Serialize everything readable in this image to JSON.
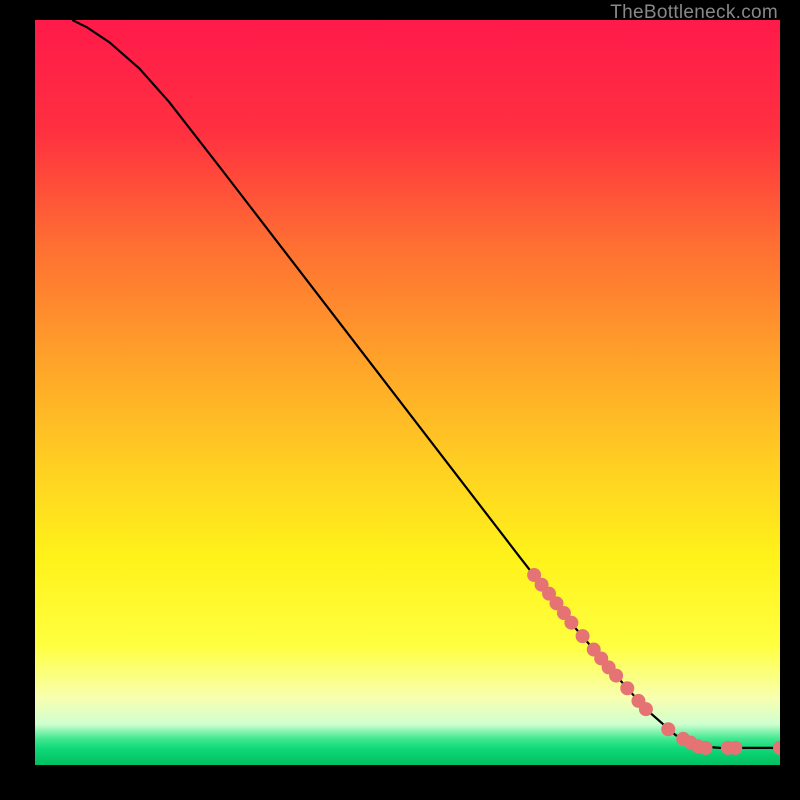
{
  "attribution": "TheBottleneck.com",
  "chart_data": {
    "type": "line",
    "title": "",
    "xlabel": "",
    "ylabel": "",
    "xlim": [
      0,
      100
    ],
    "ylim": [
      0,
      100
    ],
    "curve": [
      {
        "x": 5,
        "y": 100
      },
      {
        "x": 7,
        "y": 99
      },
      {
        "x": 10,
        "y": 97
      },
      {
        "x": 14,
        "y": 93.5
      },
      {
        "x": 18,
        "y": 89
      },
      {
        "x": 25,
        "y": 80
      },
      {
        "x": 35,
        "y": 67
      },
      {
        "x": 45,
        "y": 54
      },
      {
        "x": 55,
        "y": 41
      },
      {
        "x": 65,
        "y": 28
      },
      {
        "x": 72,
        "y": 19
      },
      {
        "x": 78,
        "y": 12
      },
      {
        "x": 82,
        "y": 7.5
      },
      {
        "x": 86,
        "y": 4
      },
      {
        "x": 89,
        "y": 2.5
      },
      {
        "x": 92,
        "y": 2.3
      },
      {
        "x": 96,
        "y": 2.3
      },
      {
        "x": 100,
        "y": 2.3
      }
    ],
    "markers": [
      {
        "x": 67,
        "y": 25.5
      },
      {
        "x": 68,
        "y": 24.2
      },
      {
        "x": 69,
        "y": 23
      },
      {
        "x": 70,
        "y": 21.7
      },
      {
        "x": 71,
        "y": 20.4
      },
      {
        "x": 72,
        "y": 19.1
      },
      {
        "x": 73.5,
        "y": 17.3
      },
      {
        "x": 75,
        "y": 15.5
      },
      {
        "x": 76,
        "y": 14.3
      },
      {
        "x": 77,
        "y": 13.1
      },
      {
        "x": 78,
        "y": 12
      },
      {
        "x": 79.5,
        "y": 10.3
      },
      {
        "x": 81,
        "y": 8.6
      },
      {
        "x": 82,
        "y": 7.5
      },
      {
        "x": 85,
        "y": 4.8
      },
      {
        "x": 87,
        "y": 3.5
      },
      {
        "x": 88,
        "y": 3
      },
      {
        "x": 89,
        "y": 2.5
      },
      {
        "x": 90,
        "y": 2.3
      },
      {
        "x": 93,
        "y": 2.3
      },
      {
        "x": 94,
        "y": 2.3
      },
      {
        "x": 100,
        "y": 2.3
      }
    ],
    "gradient_bands": [
      {
        "stop": 0.0,
        "color": "#ff1a4a"
      },
      {
        "stop": 0.15,
        "color": "#ff3040"
      },
      {
        "stop": 0.3,
        "color": "#ff6e33"
      },
      {
        "stop": 0.45,
        "color": "#ffa02a"
      },
      {
        "stop": 0.6,
        "color": "#ffd022"
      },
      {
        "stop": 0.72,
        "color": "#fff21a"
      },
      {
        "stop": 0.84,
        "color": "#ffff40"
      },
      {
        "stop": 0.91,
        "color": "#f8ffb0"
      },
      {
        "stop": 0.945,
        "color": "#d0ffd0"
      },
      {
        "stop": 0.965,
        "color": "#40e890"
      },
      {
        "stop": 0.978,
        "color": "#10d878"
      },
      {
        "stop": 1.0,
        "color": "#00c060"
      }
    ],
    "marker_color": "#e57373"
  }
}
